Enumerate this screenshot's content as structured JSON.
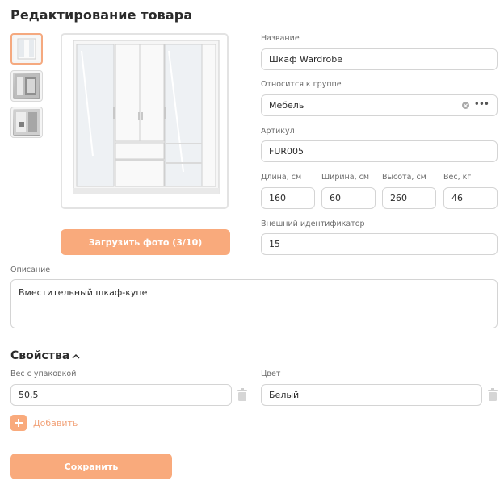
{
  "page": {
    "title": "Редактирование товара"
  },
  "photos": {
    "thumbnails": [
      {
        "name": "wardrobe-photo-1",
        "selected": true
      },
      {
        "name": "wardrobe-photo-2",
        "selected": false
      },
      {
        "name": "wardrobe-photo-3",
        "selected": false
      }
    ],
    "upload_label": "Загрузить фото (3/10)"
  },
  "form": {
    "name": {
      "label": "Название",
      "value": "Шкаф Wardrobe"
    },
    "group": {
      "label": "Относится к группе",
      "value": "Мебель",
      "clear_icon": "clear-circle-icon",
      "more_icon": "ellipsis-icon"
    },
    "sku": {
      "label": "Артикул",
      "value": "FUR005"
    },
    "length": {
      "label": "Длина, см",
      "value": "160"
    },
    "width": {
      "label": "Ширина, см",
      "value": "60"
    },
    "height": {
      "label": "Высота, см",
      "value": "260"
    },
    "weight": {
      "label": "Вес, кг",
      "value": "46"
    },
    "external_id": {
      "label": "Внешний идентификатор",
      "value": "15"
    },
    "description": {
      "label": "Описание",
      "value": "Вместительный шкаф-купе"
    }
  },
  "properties": {
    "title": "Свойства",
    "items": [
      {
        "label": "Вес с упаковкой",
        "value": "50,5"
      },
      {
        "label": "Цвет",
        "value": "Белый"
      }
    ],
    "add_label": "Добавить"
  },
  "actions": {
    "save_label": "Сохранить"
  },
  "colors": {
    "accent": "#f9aa7c",
    "border": "#d4d4d4",
    "text": "#2b2b2b",
    "muted": "#6b6b6b"
  }
}
